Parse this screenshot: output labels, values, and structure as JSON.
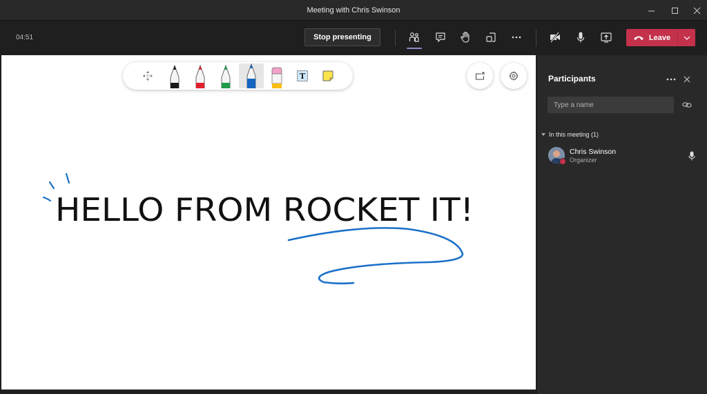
{
  "window": {
    "title": "Meeting with Chris Swinson",
    "controls": [
      "minimize",
      "maximize",
      "close"
    ]
  },
  "meeting_bar": {
    "timer": "04:51",
    "stop_presenting_label": "Stop presenting",
    "icons": [
      "participants-icon",
      "chat-icon",
      "raise-hand-icon",
      "rooms-icon",
      "more-icon",
      "camera-off-icon",
      "mic-icon",
      "share-icon"
    ],
    "leave_label": "Leave",
    "leave_color": "#c4314b",
    "active_indicator_color": "#8b8cc7"
  },
  "whiteboard": {
    "toolbar": {
      "tools": [
        {
          "name": "move",
          "icon": "move-icon"
        },
        {
          "name": "pen-black",
          "icon": "pen-icon",
          "color": "#1a1a1a"
        },
        {
          "name": "pen-red",
          "icon": "pen-icon",
          "color": "#e3202c"
        },
        {
          "name": "pen-green",
          "icon": "pen-icon",
          "color": "#1e9b4a"
        },
        {
          "name": "pen-blue",
          "icon": "pen-icon",
          "color": "#1565c0",
          "selected": true
        },
        {
          "name": "eraser",
          "icon": "eraser-icon",
          "color": "#f2a1c9"
        },
        {
          "name": "text",
          "icon": "text-box-icon",
          "glyph": "T"
        },
        {
          "name": "sticky-note",
          "icon": "sticky-note-icon",
          "color": "#fbe54b"
        }
      ]
    },
    "ink_text": "HELLO FROM ROCKET IT!",
    "ink_text_color": "#111111",
    "ink_accent_color": "#1a6fc9",
    "corner_buttons": [
      "share-to-board-icon",
      "settings-icon"
    ]
  },
  "participants_panel": {
    "title": "Participants",
    "search_placeholder": "Type a name",
    "section_label": "In this meeting (1)",
    "participants": [
      {
        "name": "Chris Swinson",
        "role": "Organizer",
        "presence": "busy",
        "presence_color": "#c4314b"
      }
    ]
  }
}
